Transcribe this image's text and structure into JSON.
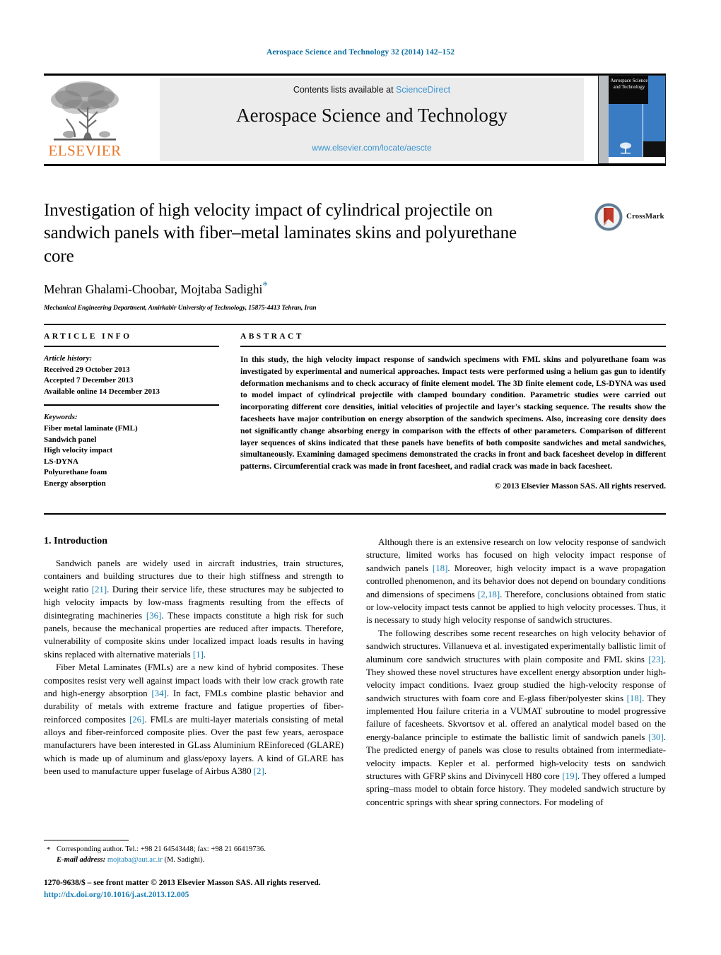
{
  "running_head": "Aerospace Science and Technology 32 (2014) 142–152",
  "masthead": {
    "publisher_wordmark": "ELSEVIER",
    "contents_prefix": "Contents lists available at ",
    "contents_link": "ScienceDirect",
    "journal_title": "Aerospace Science and Technology",
    "journal_url": "www.elsevier.com/locate/aescte",
    "cover_title": "Aerospace Science and Technology"
  },
  "article": {
    "title": "Investigation of high velocity impact of cylindrical projectile on sandwich panels with fiber–metal laminates skins and polyurethane core",
    "authors": "Mehran Ghalami-Choobar, Mojtaba Sadighi",
    "author_marker": "*",
    "affiliation": "Mechanical Engineering Department, Amirkabir University of Technology, 15875-4413 Tehran, Iran",
    "crossmark_label": "CrossMark"
  },
  "info": {
    "heading": "ARTICLE INFO",
    "history_label": "Article history:",
    "history": [
      "Received 29 October 2013",
      "Accepted 7 December 2013",
      "Available online 14 December 2013"
    ],
    "keywords_label": "Keywords:",
    "keywords": [
      "Fiber metal laminate (FML)",
      "Sandwich panel",
      "High velocity impact",
      "LS-DYNA",
      "Polyurethane foam",
      "Energy absorption"
    ]
  },
  "abstract": {
    "heading": "ABSTRACT",
    "text": "In this study, the high velocity impact response of sandwich specimens with FML skins and polyurethane foam was investigated by experimental and numerical approaches. Impact tests were performed using a helium gas gun to identify deformation mechanisms and to check accuracy of finite element model. The 3D finite element code, LS-DYNA was used to model impact of cylindrical projectile with clamped boundary condition. Parametric studies were carried out incorporating different core densities, initial velocities of projectile and layer's stacking sequence. The results show the facesheets have major contribution on energy absorption of the sandwich specimens. Also, increasing core density does not significantly change absorbing energy in comparison with the effects of other parameters. Comparison of different layer sequences of skins indicated that these panels have benefits of both composite sandwiches and metal sandwiches, simultaneously. Examining damaged specimens demonstrated the cracks in front and back facesheet develop in different patterns. Circumferential crack was made in front facesheet, and radial crack was made in back facesheet.",
    "copyright": "© 2013 Elsevier Masson SAS. All rights reserved."
  },
  "body": {
    "section_title": "1. Introduction",
    "left": {
      "p1_a": "Sandwich panels are widely used in aircraft industries, train structures, containers and building structures due to their high stiffness and strength to weight ratio ",
      "p1_r1": "[21]",
      "p1_b": ". During their service life, these structures may be subjected to high velocity impacts by low-mass fragments resulting from the effects of disintegrating machineries ",
      "p1_r2": "[36]",
      "p1_c": ". These impacts constitute a high risk for such panels, because the mechanical properties are reduced after impacts. Therefore, vulnerability of composite skins under localized impact loads results in having skins replaced with alternative materials ",
      "p1_r3": "[1]",
      "p1_d": ".",
      "p2_a": "Fiber Metal Laminates (FMLs) are a new kind of hybrid composites. These composites resist very well against impact loads with their low crack growth rate and high-energy absorption ",
      "p2_r1": "[34]",
      "p2_b": ". In fact, FMLs combine plastic behavior and durability of metals with extreme fracture and fatigue properties of fiber-reinforced composites ",
      "p2_r2": "[26]",
      "p2_c": ". FMLs are multi-layer materials consisting of metal alloys and fiber-reinforced composite plies. Over the past few years, aerospace manufacturers have been interested in GLass Aluminium REinforeced (GLARE) which is made up of aluminum and glass/epoxy layers. A kind of GLARE has been used to manufacture upper fuselage of Airbus A380 ",
      "p2_r3": "[2]",
      "p2_d": "."
    },
    "right": {
      "p1_a": "Although there is an extensive research on low velocity response of sandwich structure, limited works has focused on high velocity impact response of sandwich panels ",
      "p1_r1": "[18]",
      "p1_b": ". Moreover, high velocity impact is a wave propagation controlled phenomenon, and its behavior does not depend on boundary conditions and dimensions of specimens ",
      "p1_r2": "[2,18]",
      "p1_c": ". Therefore, conclusions obtained from static or low-velocity impact tests cannot be applied to high velocity processes. Thus, it is necessary to study high velocity response of sandwich structures.",
      "p2_a": "The following describes some recent researches on high velocity behavior of sandwich structures. Villanueva et al. investigated experimentally ballistic limit of aluminum core sandwich structures with plain composite and FML skins ",
      "p2_r1": "[23]",
      "p2_b": ". They showed these novel structures have excellent energy absorption under high-velocity impact conditions. Ivaez group studied the high-velocity response of sandwich structures with foam core and E-glass fiber/polyester skins ",
      "p2_r2": "[18]",
      "p2_c": ". They implemented Hou failure criteria in a VUMAT subroutine to model progressive failure of facesheets. Skvortsov et al. offered an analytical model based on the energy-balance principle to estimate the ballistic limit of sandwich panels ",
      "p2_r3": "[30]",
      "p2_d": ". The predicted energy of panels was close to results obtained from intermediate-velocity impacts. Kepler et al. performed high-velocity tests on sandwich structures with GFRP skins and Divinycell H80 core ",
      "p2_r4": "[19]",
      "p2_e": ". They offered a lumped spring–mass model to obtain force history. They modeled sandwich structure by concentric springs with shear spring connectors. For modeling of"
    }
  },
  "footer": {
    "corresponding_marker": "*",
    "corresponding": "Corresponding author. Tel.: +98 21 64543448; fax: +98 21 66419736.",
    "email_label": "E-mail address:",
    "email": "mojtaba@aut.ac.ir",
    "email_suffix": "(M. Sadighi).",
    "issn_line": "1270-9638/$ – see front matter © 2013 Elsevier Masson SAS. All rights reserved.",
    "doi": "http://dx.doi.org/10.1016/j.ast.2013.12.005"
  },
  "colors": {
    "link_blue": "#1a7fb5",
    "sciencedirect_blue": "#3a94d1",
    "elsevier_orange": "#e87424",
    "cover_blue": "#3a7cc4"
  }
}
